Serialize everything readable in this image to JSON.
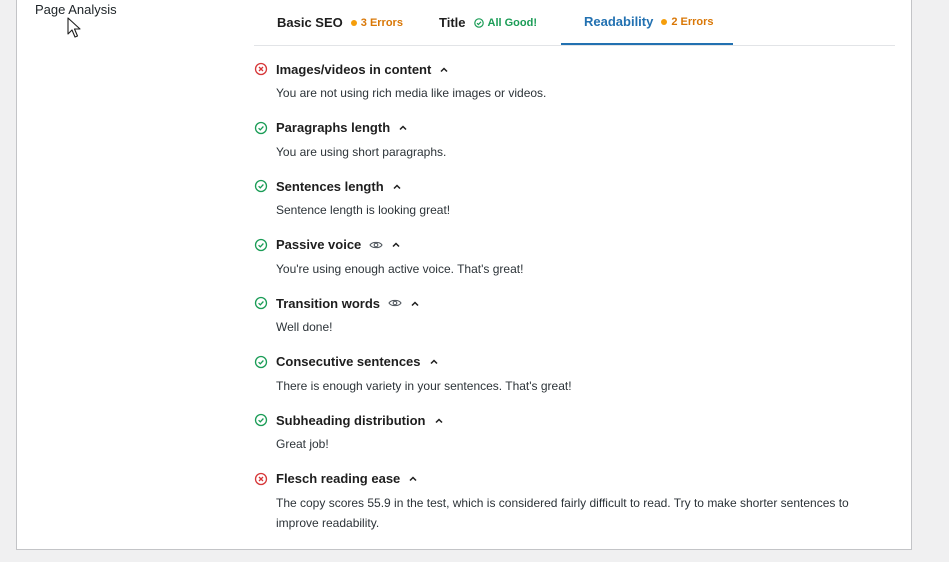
{
  "page_title": "Page Analysis",
  "tabs": [
    {
      "label": "Basic SEO",
      "badge": "3 Errors",
      "status": "warn"
    },
    {
      "label": "Title",
      "badge": "All Good!",
      "status": "good"
    },
    {
      "label": "Readability",
      "badge": "2 Errors",
      "status": "warn",
      "active": true
    }
  ],
  "colors": {
    "accent": "#2271b1",
    "error": "#d63638",
    "success": "#1a9c56",
    "warning": "#f59e0b"
  },
  "checks": [
    {
      "title": "Images/videos in content",
      "status": "error",
      "eye": false,
      "description": "You are not using rich media like images or videos."
    },
    {
      "title": "Paragraphs length",
      "status": "success",
      "eye": false,
      "description": "You are using short paragraphs."
    },
    {
      "title": "Sentences length",
      "status": "success",
      "eye": false,
      "description": "Sentence length is looking great!"
    },
    {
      "title": "Passive voice",
      "status": "success",
      "eye": true,
      "description": "You're using enough active voice. That's great!"
    },
    {
      "title": "Transition words",
      "status": "success",
      "eye": true,
      "description": "Well done!"
    },
    {
      "title": "Consecutive sentences",
      "status": "success",
      "eye": false,
      "description": "There is enough variety in your sentences. That's great!"
    },
    {
      "title": "Subheading distribution",
      "status": "success",
      "eye": false,
      "description": "Great job!"
    },
    {
      "title": "Flesch reading ease",
      "status": "error",
      "eye": false,
      "description": "The copy scores 55.9 in the test, which is considered fairly difficult to read. Try to make shorter sentences to improve readability."
    }
  ]
}
